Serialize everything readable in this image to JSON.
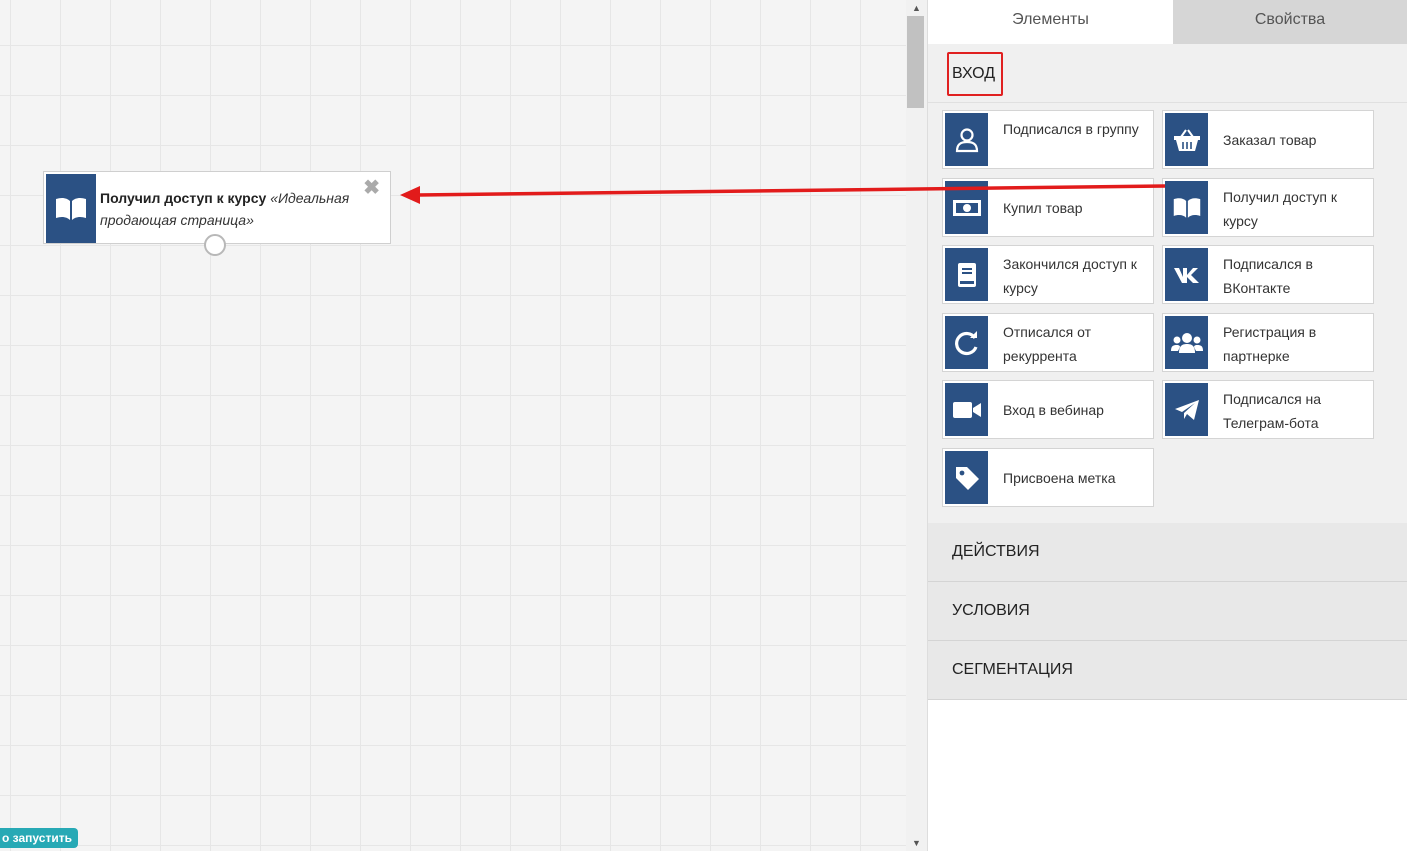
{
  "canvas": {
    "node": {
      "title": "Получил доступ к курсу",
      "subtitle": "«Идеальная продающая страница»",
      "close": "✖",
      "icon": "book-open-icon"
    },
    "launch_button": "о запустить"
  },
  "panel": {
    "tabs": [
      "Элементы",
      "Свойства"
    ],
    "active_tab": "Элементы",
    "section_open": "ВХОД",
    "elements": [
      {
        "label": "Подписался в группу",
        "icon": "user-icon"
      },
      {
        "label": "Заказал товар",
        "icon": "basket-icon"
      },
      {
        "label": "Купил товар",
        "icon": "money-icon"
      },
      {
        "label": "Получил доступ к курсу",
        "icon": "book-open-icon"
      },
      {
        "label": "Закончился доступ к курсу",
        "icon": "book-closed-icon"
      },
      {
        "label": "Подписался в ВКонтакте",
        "icon": "vk-icon"
      },
      {
        "label": "Отписался от рекуррента",
        "icon": "refresh-icon"
      },
      {
        "label": "Регистрация в партнерке",
        "icon": "users-icon"
      },
      {
        "label": "Вход в вебинар",
        "icon": "video-camera-icon"
      },
      {
        "label": "Подписался на Телеграм-бота",
        "icon": "telegram-icon"
      },
      {
        "label": "Присвоена метка",
        "icon": "tag-icon"
      }
    ],
    "sections": [
      "ДЕЙСТВИЯ",
      "УСЛОВИЯ",
      "СЕГМЕНТАЦИЯ"
    ]
  },
  "colors": {
    "icon_bg": "#2b5184",
    "highlight": "#e02020",
    "arrow": "#e21b1b",
    "launch_bg": "#27a9b5"
  }
}
